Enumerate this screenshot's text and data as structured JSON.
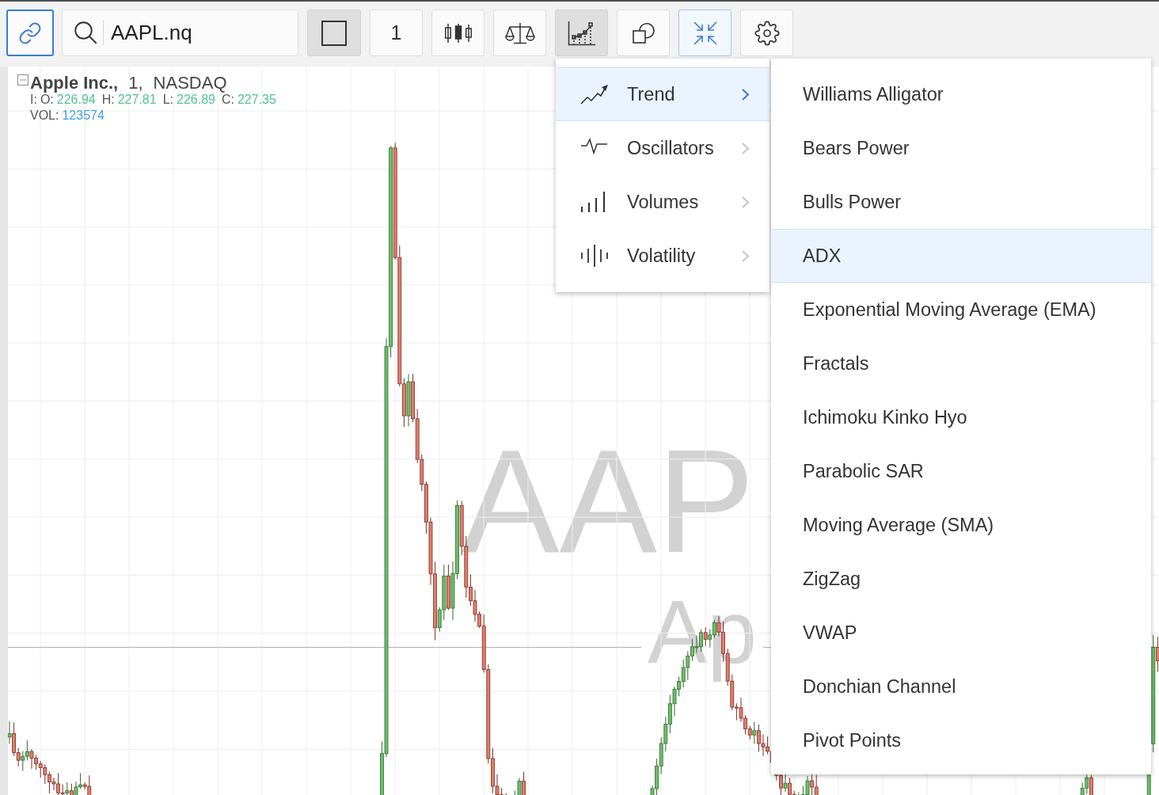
{
  "toolbar": {
    "items": [
      {
        "kind": "link",
        "active": true,
        "pressed": false
      },
      {
        "kind": "search",
        "value": "AAPL.nq"
      },
      {
        "kind": "frame",
        "active": false,
        "pressed": true
      },
      {
        "kind": "interval",
        "label": "1",
        "active": false,
        "pressed": false
      },
      {
        "kind": "candles",
        "active": false,
        "pressed": false
      },
      {
        "kind": "compare",
        "active": false,
        "pressed": false
      },
      {
        "kind": "indicators",
        "active": false,
        "pressed": true
      },
      {
        "kind": "shapes",
        "active": false,
        "pressed": false
      },
      {
        "kind": "fit",
        "active": true,
        "pressed": false
      },
      {
        "kind": "settings",
        "active": false,
        "pressed": false
      }
    ]
  },
  "chart": {
    "legend": {
      "expanded": true,
      "symbol": "Apple Inc.,",
      "interval": "1,",
      "exchange": "NASDAQ",
      "prefix": "I:",
      "ohlc": [
        {
          "label": "O:",
          "value": "226.94"
        },
        {
          "label": "H:",
          "value": "227.81"
        },
        {
          "label": "L:",
          "value": "226.89"
        },
        {
          "label": "C:",
          "value": "227.35"
        }
      ],
      "volume": {
        "label": "VOL:",
        "value": "123574"
      }
    },
    "watermark": {
      "symbol": "AAP",
      "name": "Ap"
    }
  },
  "indicator_menu": {
    "categories": [
      {
        "kind": "trend",
        "label": "Trend",
        "selected": true
      },
      {
        "kind": "oscillators",
        "label": "Oscillators",
        "selected": false
      },
      {
        "kind": "volumes",
        "label": "Volumes",
        "selected": false
      },
      {
        "kind": "volatility",
        "label": "Volatility",
        "selected": false
      }
    ],
    "submenu": {
      "items": [
        {
          "label": "Williams Alligator",
          "selected": false
        },
        {
          "label": "Bears Power",
          "selected": false
        },
        {
          "label": "Bulls Power",
          "selected": false
        },
        {
          "label": "ADX",
          "selected": true
        },
        {
          "label": "Exponential Moving Average (EMA)",
          "selected": false
        },
        {
          "label": "Fractals",
          "selected": false
        },
        {
          "label": "Ichimoku Kinko Hyo",
          "selected": false
        },
        {
          "label": "Parabolic SAR",
          "selected": false
        },
        {
          "label": "Moving Average (SMA)",
          "selected": false
        },
        {
          "label": "ZigZag",
          "selected": false
        },
        {
          "label": "VWAP",
          "selected": false
        },
        {
          "label": "Donchian Channel",
          "selected": false
        },
        {
          "label": "Pivot Points",
          "selected": false
        }
      ]
    }
  }
}
